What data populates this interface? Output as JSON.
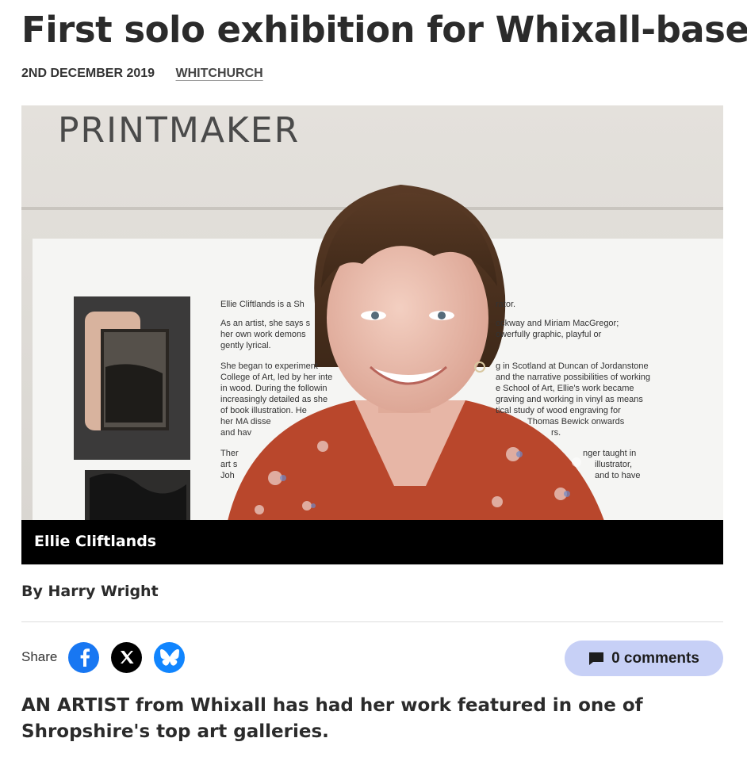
{
  "article": {
    "headline": "First solo exhibition for Whixall-based artist",
    "date": "2ND DECEMBER 2019",
    "location_tag": "WHITCHURCH",
    "byline": "By Harry Wright",
    "lead": "AN ARTIST from Whixall has had her work featured in one of Shropshire's top art galleries."
  },
  "hero": {
    "caption": "Ellie Cliftlands",
    "wall_title": "PRINTMAKER",
    "panel_lines_left": [
      "Ellie Cliftlands is a Sh",
      "As an artist, she says s",
      "her own work demons",
      "gently lyrical.",
      "She began to experiment",
      "College of Art, led by her inte",
      "in wood.   During the followin",
      "increasingly detailed as she",
      "of book illustration. He",
      "her MA disse",
      "and hav",
      "Ther",
      "art s",
      "Joh"
    ],
    "panel_lines_right": [
      "rator.",
      "ockway and Miriam MacGregor;",
      "owerfully graphic, playful or",
      "g in Scotland at Duncan of Jordanstone",
      "and the narrative possibilities of working",
      "e School of Art, Ellie's work became",
      "graving and working in vinyl as means",
      "tical study of wood engraving for",
      "Thomas Bewick onwards",
      "rs.",
      "nger taught in",
      "illustrator,",
      "and to have"
    ]
  },
  "share": {
    "label": "Share",
    "facebook_color": "#1877f2",
    "x_color": "#000000",
    "bluesky_color": "#1185fe"
  },
  "comments": {
    "label": "0 comments",
    "bg_color": "#c7d0f6"
  }
}
